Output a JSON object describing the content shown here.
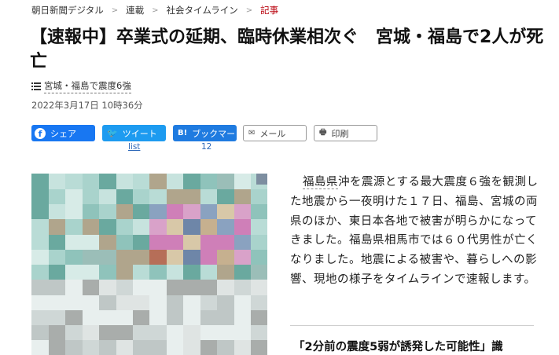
{
  "breadcrumb": {
    "items": [
      "朝日新聞デジタル",
      "連載",
      "社会タイムライン",
      "記事"
    ],
    "separator": ">"
  },
  "article": {
    "title": "【速報中】卒業式の延期、臨時休業相次ぐ　宮城・福島で2人が死亡",
    "topic_link": "宮城・福島で震度6強",
    "date": "2022年3月17日 10時36分",
    "lead": {
      "keyword": "福島県",
      "text": "沖を震源とする最大震度６強を観測した地震から一夜明けた１７日、福島、宮城の両県のほか、東日本各地で被害が明らかになってきました。福島県相馬市では６０代男性が亡くなりました。地震による被害や、暮らしへの影響、現地の様子をタイムラインで速報します。"
    },
    "subheading": "「2分前の震度5弱が誘発した可能性」識"
  },
  "share": {
    "facebook": {
      "icon": "facebook-icon",
      "label": "シェア",
      "color": "#1877f2"
    },
    "twitter": {
      "icon": "twitter-icon",
      "label": "ツイート",
      "count": "list",
      "color": "#1d9bf0"
    },
    "hatena": {
      "icon": "hatena-bookmark-icon",
      "label": "ブックマー",
      "count": "12",
      "color": "#1f7be0"
    },
    "mail": {
      "icon": "mail-icon",
      "label": "メール"
    },
    "print": {
      "icon": "print-icon",
      "label": "印刷"
    }
  },
  "colors": {
    "breadcrumb_current": "#b8000b",
    "count_link": "#2a66b8"
  }
}
